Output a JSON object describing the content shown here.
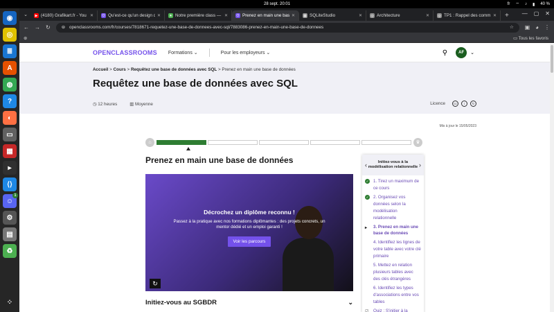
{
  "system": {
    "clock": "28 sept.  20:01",
    "battery": "40 %",
    "lang": "fr"
  },
  "dock": [
    {
      "name": "firefox-alt-icon",
      "color": "#1565c0",
      "glyph": "◉"
    },
    {
      "name": "rhythmbox-icon",
      "color": "#e0c200",
      "glyph": "◎"
    },
    {
      "name": "libreoffice-writer-icon",
      "color": "#1976d2",
      "glyph": "≣"
    },
    {
      "name": "software-center-icon",
      "color": "#e65100",
      "glyph": "A"
    },
    {
      "name": "chrome-icon",
      "color": "#34a853",
      "glyph": "◍"
    },
    {
      "name": "help-icon",
      "color": "#1e88e5",
      "glyph": "?"
    },
    {
      "name": "firefox-icon",
      "color": "#ff7043",
      "glyph": "◐"
    },
    {
      "name": "files-icon",
      "color": "#616161",
      "glyph": "▭"
    },
    {
      "name": "apps-grid-icon",
      "color": "#c62828",
      "glyph": "▦"
    },
    {
      "name": "terminal-icon",
      "color": "#303030",
      "glyph": "▸"
    },
    {
      "name": "vscode-icon",
      "color": "#1e88e5",
      "glyph": "⟨⟩"
    },
    {
      "name": "discord-icon",
      "color": "#5865f2",
      "glyph": "☺",
      "badge": "1"
    },
    {
      "name": "settings-icon",
      "color": "#555555",
      "glyph": "⚙"
    },
    {
      "name": "disk-icon",
      "color": "#777777",
      "glyph": "▤"
    },
    {
      "name": "trash-icon",
      "color": "#4caf50",
      "glyph": "♻"
    }
  ],
  "tabs": [
    {
      "title": "(4180) Grafikart.fr - You",
      "color": "#ff0000",
      "glyph": "▶"
    },
    {
      "title": "Qu'est-ce qu'un design d",
      "color": "#7451eb",
      "glyph": "O"
    },
    {
      "title": "Notre première class — ",
      "color": "#4caf50",
      "glyph": "★"
    },
    {
      "title": "Prenez en main une bas",
      "color": "#7451eb",
      "glyph": "O",
      "active": true
    },
    {
      "title": "SQLiteStudio",
      "color": "#888888",
      "glyph": "▦"
    },
    {
      "title": "Architecture",
      "color": "#888888",
      "glyph": "◎"
    },
    {
      "title": "TP1 : Rappel des comm",
      "color": "#888888",
      "glyph": "◎"
    }
  ],
  "address": {
    "url": "openclassrooms.com/fr/courses/7818671-requetez-une-base-de-donnees-avec-sql/7883086-prenez-en-main-une-base-de-donnees"
  },
  "bookmarks": {
    "all": "Tous les favoris"
  },
  "header": {
    "logo": "OPENCLASSROOMS",
    "nav1": "Formations",
    "nav2": "Pour les employeurs",
    "avatar": "AF"
  },
  "breadcrumb": {
    "home": "Accueil",
    "courses": "Cours",
    "course": "Requêtez une base de données avec SQL",
    "current": "Prenez en main une base de données"
  },
  "course": {
    "title": "Requêtez une base de données avec SQL",
    "duration": "12 heures",
    "level": "Moyenne",
    "license": "Licence",
    "updated": "Mis à jour le 15/05/2023"
  },
  "progress": {
    "segments": 5,
    "completed_fraction": 0.2
  },
  "chapter": {
    "title": "Prenez en main une base de données"
  },
  "video": {
    "title": "Décrochez un diplôme reconnu !",
    "text": "Passez à la pratique avec nos formations diplômantes : des projets concrets, un mentor dédié et un emploi garanti !",
    "button": "Voir les parcours"
  },
  "section": {
    "title": "Initiez-vous au SGBDR",
    "next_number": "7"
  },
  "toc": {
    "title": "Initiez-vous à la modélisation relationnelle",
    "items": [
      {
        "label": "1. Tirez un maximum de ce cours",
        "status": "done"
      },
      {
        "label": "2. Organisez vos données selon la modélisation relationnelle",
        "status": "done"
      },
      {
        "label": "3. Prenez en main une base de données",
        "status": "current"
      },
      {
        "label": "4. Identifiez les lignes de votre table avec votre clé primaire",
        "status": "todo"
      },
      {
        "label": "5. Mettez en relation plusieurs tables avec des clés étrangères",
        "status": "todo"
      },
      {
        "label": "6. Identifiez les types d'associations entre vos tables",
        "status": "todo"
      },
      {
        "label": "Quiz : S'initier à la",
        "status": "quiz"
      }
    ]
  }
}
